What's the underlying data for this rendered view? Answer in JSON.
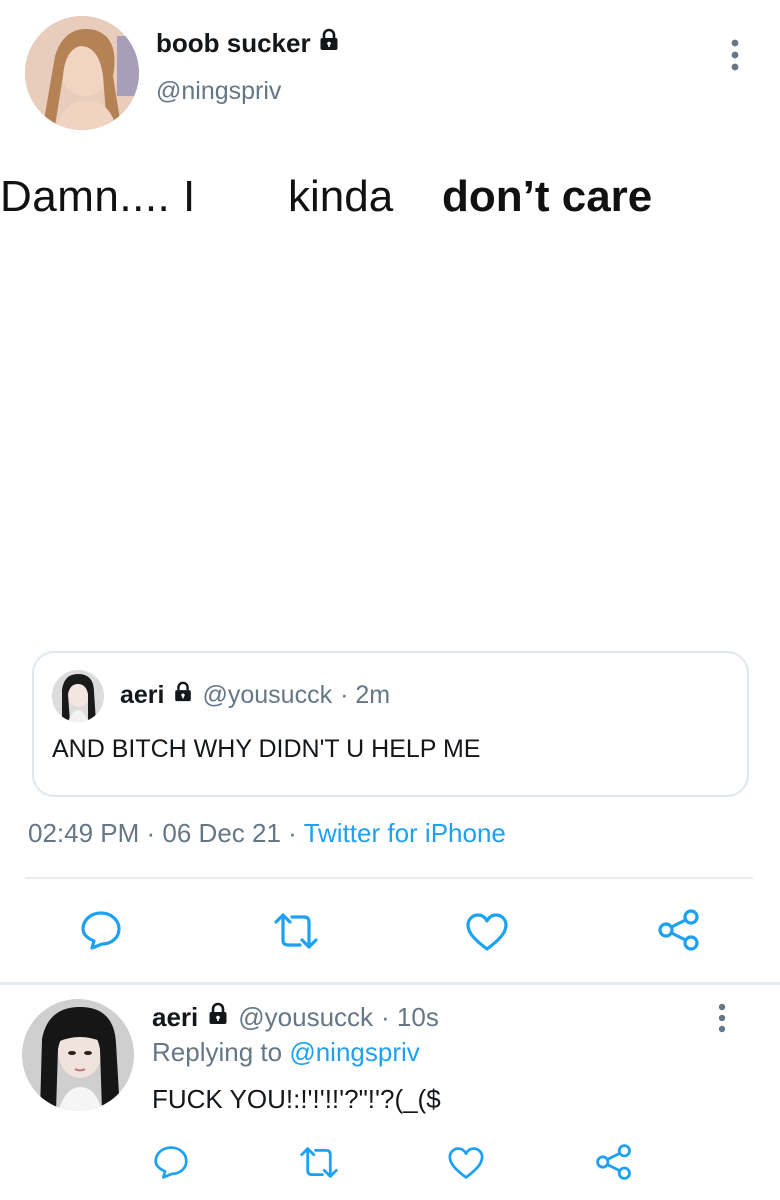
{
  "tweet": {
    "display_name": "boob sucker",
    "handle": "@ningspriv",
    "protected_icon": "lock-icon",
    "meme": {
      "text_1": "Damn.... I",
      "text_2": "kinda",
      "text_3": "don’t care"
    },
    "quoted": {
      "name": "aeri",
      "handle": "@yousucck",
      "time": "· 2m",
      "text": "AND BITCH WHY DIDN'T U HELP ME"
    },
    "timestamp": "02:49 PM · 06 Dec 21 · ",
    "source": "Twitter for iPhone",
    "actions": [
      "reply-icon",
      "retweet-icon",
      "like-icon",
      "share-icon"
    ],
    "more_icon": "more-vertical-icon"
  },
  "reply": {
    "name": "aeri",
    "handle": "@yousucck",
    "time": "· 10s",
    "replying_prefix": "Replying to",
    "replying_to": "@ningspriv",
    "text": "FUCK YOU!:!'!'!!'?\"!'?(_($"
  },
  "colors": {
    "accent": "#1da1f2",
    "secondary_text": "#657786",
    "icon": "#1da1f2",
    "divider": "#e6ecf0"
  }
}
